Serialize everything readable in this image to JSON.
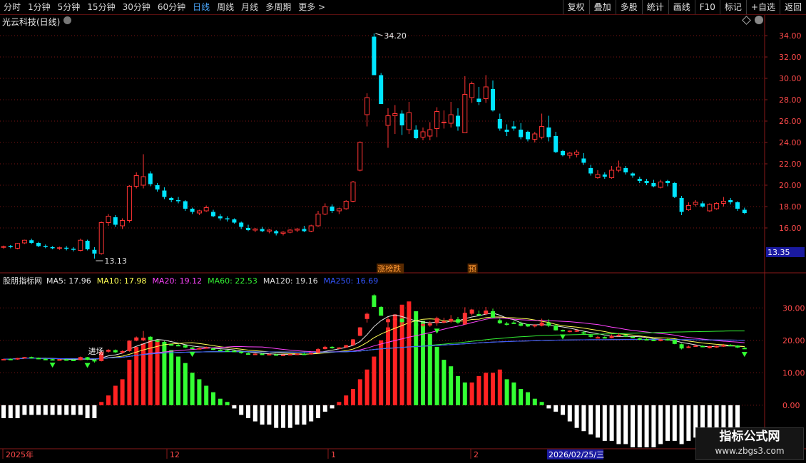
{
  "toolbar": {
    "timeframes": [
      "分时",
      "1分钟",
      "5分钟",
      "15分钟",
      "30分钟",
      "60分钟",
      "日线",
      "周线",
      "月线",
      "多周期",
      "更多"
    ],
    "active": "日线",
    "right_tools": [
      "复权",
      "叠加",
      "多股",
      "统计",
      "画线",
      "F10",
      "标记",
      "+自选",
      "返回"
    ]
  },
  "stock": {
    "name": "光云科技(日线)"
  },
  "price_panel": {
    "y_ticks": [
      "34.00",
      "32.00",
      "30.00",
      "28.00",
      "26.00",
      "24.00",
      "22.00",
      "20.00",
      "18.00",
      "16.00"
    ],
    "high_label": "34.20",
    "low_label": "13.13",
    "current_price": "13.35",
    "markers": [
      "涨榜跌",
      "预"
    ]
  },
  "indicator_panel": {
    "name": "股朋指标网",
    "ma_labels": [
      {
        "text": "MA5: 17.96",
        "color": "#e8e8e8"
      },
      {
        "text": "MA10: 17.98",
        "color": "#ffff55"
      },
      {
        "text": "MA20: 19.12",
        "color": "#ff44ff"
      },
      {
        "text": "MA60: 22.53",
        "color": "#33ee33"
      },
      {
        "text": "MA120: 19.16",
        "color": "#e0e0e0"
      },
      {
        "text": "MA250: 16.69",
        "color": "#3355ff"
      }
    ],
    "y_ticks": [
      "30.00",
      "20.00",
      "10.00",
      "0.00"
    ],
    "signal_label": "进场"
  },
  "x_axis": {
    "labels": [
      "2025年",
      "12",
      "1",
      "2"
    ],
    "cursor_date": "2026/02/25/三"
  },
  "watermark": {
    "line1": "指标公式网",
    "line2": "www.zbgs3.com"
  },
  "colors": {
    "up": "#ff3333",
    "down": "#00e5ff",
    "bull_bar": "#33ff33",
    "bear_bar": "#ffffff",
    "grid": "#7a1515"
  },
  "chart_data": {
    "type": "candlestick",
    "candles": [
      [
        14.2,
        14.35,
        14.05,
        14.25
      ],
      [
        14.3,
        14.4,
        14.1,
        14.2
      ],
      [
        14.1,
        14.6,
        14.0,
        14.55
      ],
      [
        14.6,
        14.9,
        14.5,
        14.85
      ],
      [
        14.85,
        15.0,
        14.5,
        14.6
      ],
      [
        14.6,
        14.7,
        14.2,
        14.3
      ],
      [
        14.3,
        14.45,
        14.1,
        14.2
      ],
      [
        14.2,
        14.3,
        14.0,
        14.1
      ],
      [
        14.1,
        14.25,
        13.95,
        14.15
      ],
      [
        14.15,
        14.3,
        13.9,
        14.05
      ],
      [
        14.05,
        14.2,
        13.8,
        13.95
      ],
      [
        13.9,
        15.0,
        13.8,
        14.85
      ],
      [
        14.8,
        14.9,
        13.9,
        14.0
      ],
      [
        13.95,
        14.2,
        13.13,
        13.6
      ],
      [
        13.6,
        16.6,
        13.5,
        16.5
      ],
      [
        16.5,
        17.3,
        16.2,
        17.1
      ],
      [
        17.0,
        17.2,
        16.1,
        16.3
      ],
      [
        16.2,
        16.9,
        15.9,
        16.7
      ],
      [
        16.7,
        20.0,
        16.5,
        19.9
      ],
      [
        19.9,
        21.2,
        19.7,
        20.9
      ],
      [
        20.0,
        22.9,
        19.7,
        20.8
      ],
      [
        21.1,
        21.3,
        19.9,
        20.1
      ],
      [
        20.0,
        20.2,
        19.4,
        19.6
      ],
      [
        19.5,
        19.8,
        18.7,
        18.9
      ],
      [
        18.8,
        18.9,
        18.4,
        18.6
      ],
      [
        18.6,
        18.9,
        18.3,
        18.5
      ],
      [
        18.5,
        18.6,
        17.6,
        17.8
      ],
      [
        17.8,
        17.9,
        17.3,
        17.5
      ],
      [
        17.4,
        17.7,
        17.2,
        17.6
      ],
      [
        17.6,
        18.1,
        17.5,
        17.9
      ],
      [
        17.5,
        17.7,
        17.0,
        17.1
      ],
      [
        17.1,
        17.3,
        16.7,
        16.9
      ],
      [
        16.9,
        17.1,
        16.6,
        16.8
      ],
      [
        16.8,
        16.9,
        16.4,
        16.5
      ],
      [
        16.5,
        16.6,
        15.9,
        16.1
      ],
      [
        16.0,
        16.3,
        15.7,
        15.8
      ],
      [
        15.8,
        16.0,
        15.6,
        15.9
      ],
      [
        15.9,
        16.1,
        15.6,
        15.7
      ],
      [
        15.7,
        15.9,
        15.5,
        15.8
      ],
      [
        15.7,
        15.8,
        15.3,
        15.5
      ],
      [
        15.5,
        15.7,
        15.3,
        15.6
      ],
      [
        15.6,
        15.9,
        15.5,
        15.8
      ],
      [
        15.8,
        16.0,
        15.6,
        15.9
      ],
      [
        15.9,
        16.2,
        15.6,
        15.7
      ],
      [
        15.7,
        16.3,
        15.6,
        16.2
      ],
      [
        16.2,
        17.6,
        16.1,
        17.3
      ],
      [
        17.3,
        18.3,
        17.2,
        18.0
      ],
      [
        18.0,
        18.2,
        17.4,
        17.6
      ],
      [
        17.6,
        17.9,
        17.3,
        17.8
      ],
      [
        17.8,
        18.6,
        17.7,
        18.5
      ],
      [
        18.5,
        20.4,
        18.4,
        20.3
      ],
      [
        21.4,
        24.1,
        21.3,
        24.0
      ],
      [
        26.6,
        28.6,
        25.5,
        28.2
      ],
      [
        33.9,
        34.2,
        30.5,
        30.3
      ],
      [
        30.3,
        30.5,
        27.8,
        27.6
      ],
      [
        25.6,
        27.2,
        23.5,
        26.5
      ],
      [
        26.5,
        27.5,
        24.8,
        26.7
      ],
      [
        26.7,
        27.0,
        24.7,
        25.6
      ],
      [
        25.2,
        27.8,
        24.8,
        26.8
      ],
      [
        25.2,
        25.6,
        24.3,
        24.4
      ],
      [
        24.5,
        25.4,
        24.2,
        25.0
      ],
      [
        24.6,
        25.9,
        24.2,
        25.2
      ],
      [
        25.3,
        27.3,
        24.5,
        26.9
      ],
      [
        25.9,
        27.0,
        25.3,
        25.9
      ],
      [
        25.8,
        27.8,
        25.4,
        26.6
      ],
      [
        26.5,
        27.2,
        25.1,
        25.5
      ],
      [
        24.9,
        30.2,
        24.9,
        28.5
      ],
      [
        28.2,
        29.7,
        27.7,
        29.5
      ],
      [
        28.1,
        29.2,
        27.5,
        27.8
      ],
      [
        28.1,
        30.3,
        27.7,
        29.2
      ],
      [
        29.0,
        29.8,
        26.9,
        27.0
      ],
      [
        26.2,
        26.7,
        25.1,
        25.3
      ],
      [
        25.2,
        25.7,
        24.6,
        25.0
      ],
      [
        25.5,
        26.0,
        25.1,
        25.3
      ],
      [
        25.2,
        25.8,
        24.3,
        24.5
      ],
      [
        25.0,
        25.1,
        24.1,
        24.3
      ],
      [
        24.3,
        25.0,
        24.0,
        24.8
      ],
      [
        24.5,
        26.7,
        24.3,
        25.5
      ],
      [
        25.4,
        26.5,
        24.1,
        24.5
      ],
      [
        24.6,
        25.0,
        23.0,
        23.1
      ],
      [
        23.2,
        23.3,
        22.7,
        22.8
      ],
      [
        22.8,
        23.1,
        22.5,
        23.0
      ],
      [
        22.9,
        23.3,
        22.6,
        23.1
      ],
      [
        22.5,
        23.0,
        21.9,
        22.1
      ],
      [
        21.6,
        21.9,
        20.9,
        21.1
      ],
      [
        20.7,
        21.4,
        20.6,
        21.0
      ],
      [
        21.0,
        21.2,
        20.6,
        20.8
      ],
      [
        20.7,
        21.8,
        20.6,
        21.4
      ],
      [
        21.4,
        22.3,
        21.2,
        21.7
      ],
      [
        21.6,
        21.8,
        21.0,
        21.2
      ],
      [
        21.1,
        21.2,
        20.7,
        20.9
      ],
      [
        20.6,
        20.8,
        20.2,
        20.4
      ],
      [
        20.4,
        20.6,
        20.0,
        20.2
      ],
      [
        20.2,
        20.5,
        19.8,
        19.9
      ],
      [
        19.8,
        20.5,
        19.7,
        20.3
      ],
      [
        20.4,
        20.5,
        19.9,
        20.2
      ],
      [
        20.2,
        20.3,
        18.8,
        18.9
      ],
      [
        18.8,
        19.0,
        17.2,
        17.5
      ],
      [
        17.7,
        18.4,
        17.6,
        18.1
      ],
      [
        18.2,
        18.6,
        18.0,
        18.4
      ],
      [
        18.3,
        18.5,
        17.9,
        18.0
      ],
      [
        17.6,
        18.3,
        17.5,
        18.2
      ],
      [
        17.8,
        18.4,
        17.7,
        18.3
      ],
      [
        18.3,
        18.9,
        18.0,
        18.5
      ],
      [
        18.6,
        18.8,
        18.2,
        18.4
      ],
      [
        18.4,
        18.5,
        17.6,
        17.8
      ],
      [
        17.7,
        17.9,
        17.3,
        17.4
      ]
    ],
    "oscillator": [
      -4,
      -4,
      -4,
      -3,
      -3,
      -3,
      -3,
      -3,
      -3,
      -3,
      -3,
      -3,
      -4,
      -4,
      1,
      3,
      6,
      8,
      14,
      18,
      19,
      20,
      20,
      19,
      17,
      15,
      13,
      10,
      8,
      6,
      4,
      2,
      1,
      -1,
      -3,
      -4,
      -5,
      -6,
      -6,
      -7,
      -7,
      -7,
      -6,
      -6,
      -5,
      -4,
      -2,
      -1,
      1,
      3,
      5,
      8,
      11,
      15,
      20,
      24,
      28,
      31,
      32,
      29,
      26,
      22,
      18,
      14,
      12,
      9,
      7,
      7,
      9,
      10,
      10,
      11,
      8,
      7,
      5,
      4,
      2,
      1,
      -1,
      -2,
      -3,
      -5,
      -7,
      -8,
      -9,
      -10,
      -11,
      -11,
      -12,
      -12,
      -13,
      -13,
      -13,
      -13,
      -12,
      -11,
      -11,
      -12,
      -11,
      -10,
      -10,
      -9,
      -9,
      -8,
      -8,
      -7
    ],
    "ma_series": [
      "MA5",
      "MA10",
      "MA20",
      "MA60",
      "MA120",
      "MA250"
    ],
    "price_ylim": [
      13.0,
      34.8
    ],
    "osc_ylim": [
      -13,
      36
    ]
  }
}
